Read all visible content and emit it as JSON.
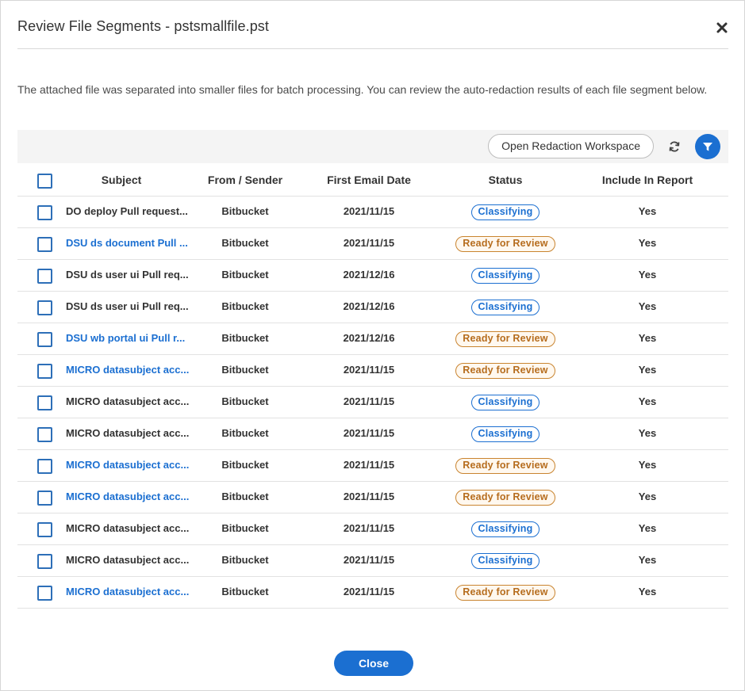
{
  "dialog": {
    "title": "Review File Segments - pstsmallfile.pst",
    "description": "The attached file was separated into smaller files for batch processing. You can review the auto-redaction results of each file segment below."
  },
  "toolbar": {
    "open_workspace_label": "Open Redaction Workspace",
    "refresh_icon": "refresh-icon",
    "filter_icon": "filter-icon"
  },
  "table": {
    "headers": {
      "subject": "Subject",
      "from": "From / Sender",
      "date": "First Email Date",
      "status": "Status",
      "report": "Include In Report"
    },
    "rows": [
      {
        "subject": "DO deploy Pull request...",
        "from": "Bitbucket",
        "date": "2021/11/15",
        "status": "Classifying",
        "report": "Yes"
      },
      {
        "subject": "DSU ds document Pull ...",
        "from": "Bitbucket",
        "date": "2021/11/15",
        "status": "Ready for Review",
        "report": "Yes"
      },
      {
        "subject": "DSU ds user ui Pull req...",
        "from": "Bitbucket",
        "date": "2021/12/16",
        "status": "Classifying",
        "report": "Yes"
      },
      {
        "subject": "DSU ds user ui Pull req...",
        "from": "Bitbucket",
        "date": "2021/12/16",
        "status": "Classifying",
        "report": "Yes"
      },
      {
        "subject": "DSU wb portal ui Pull r...",
        "from": "Bitbucket",
        "date": "2021/12/16",
        "status": "Ready for Review",
        "report": "Yes"
      },
      {
        "subject": "MICRO datasubject acc...",
        "from": "Bitbucket",
        "date": "2021/11/15",
        "status": "Ready for Review",
        "report": "Yes"
      },
      {
        "subject": "MICRO datasubject acc...",
        "from": "Bitbucket",
        "date": "2021/11/15",
        "status": "Classifying",
        "report": "Yes"
      },
      {
        "subject": "MICRO datasubject acc...",
        "from": "Bitbucket",
        "date": "2021/11/15",
        "status": "Classifying",
        "report": "Yes"
      },
      {
        "subject": "MICRO datasubject acc...",
        "from": "Bitbucket",
        "date": "2021/11/15",
        "status": "Ready for Review",
        "report": "Yes"
      },
      {
        "subject": "MICRO datasubject acc...",
        "from": "Bitbucket",
        "date": "2021/11/15",
        "status": "Ready for Review",
        "report": "Yes"
      },
      {
        "subject": "MICRO datasubject acc...",
        "from": "Bitbucket",
        "date": "2021/11/15",
        "status": "Classifying",
        "report": "Yes"
      },
      {
        "subject": "MICRO datasubject acc...",
        "from": "Bitbucket",
        "date": "2021/11/15",
        "status": "Classifying",
        "report": "Yes"
      },
      {
        "subject": "MICRO datasubject acc...",
        "from": "Bitbucket",
        "date": "2021/11/15",
        "status": "Ready for Review",
        "report": "Yes"
      }
    ]
  },
  "footer": {
    "close_label": "Close"
  },
  "colors": {
    "accent": "#1b6fd1",
    "ready": "#c9842f"
  }
}
